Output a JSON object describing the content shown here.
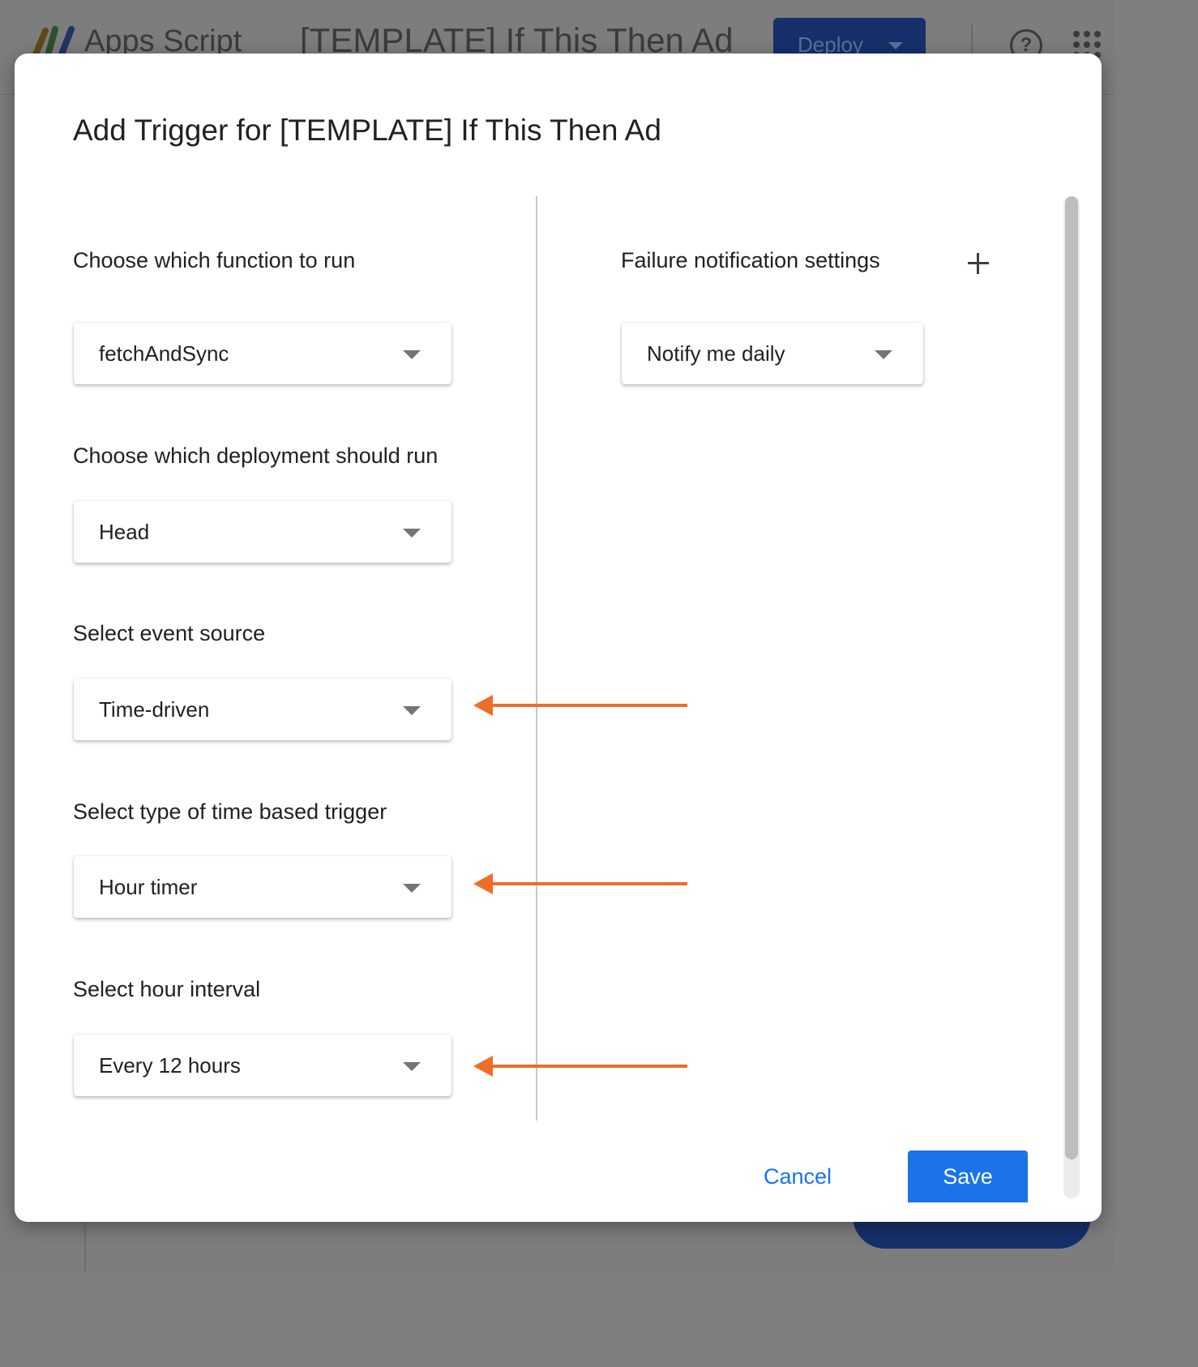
{
  "background": {
    "product_name": "Apps Script",
    "project_title": "[TEMPLATE] If This Then Ad",
    "deploy_label": "Deploy",
    "help_icon": "help-circle-icon",
    "apps_icon": "apps-grid-icon"
  },
  "dialog": {
    "title": "Add Trigger for [TEMPLATE] If This Then Ad",
    "left": {
      "function_label": "Choose which function to run",
      "function_value": "fetchAndSync",
      "deployment_label": "Choose which deployment should run",
      "deployment_value": "Head",
      "event_source_label": "Select event source",
      "event_source_value": "Time-driven",
      "time_trigger_label": "Select type of time based trigger",
      "time_trigger_value": "Hour timer",
      "hour_interval_label": "Select hour interval",
      "hour_interval_value": "Every 12 hours"
    },
    "right": {
      "failure_label": "Failure notification settings",
      "failure_value": "Notify me daily",
      "add_icon": "plus-icon"
    },
    "buttons": {
      "cancel": "Cancel",
      "save": "Save"
    }
  },
  "colors": {
    "accent": "#1a73e8",
    "annotation_arrow": "#ef6d2b",
    "overlay": "#7f7f7f"
  }
}
